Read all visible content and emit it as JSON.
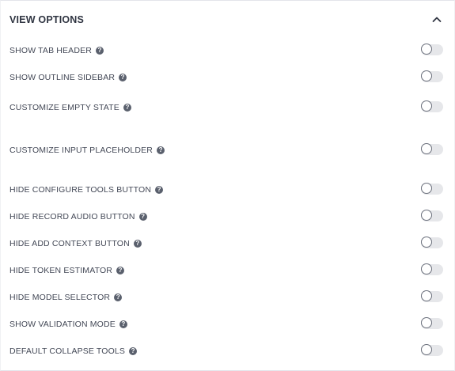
{
  "panel": {
    "title": "VIEW OPTIONS",
    "collapse_icon": "chevron-up-icon",
    "expanded": true
  },
  "options": [
    {
      "id": "show-tab-header",
      "label": "SHOW TAB HEADER",
      "enabled": false
    },
    {
      "id": "show-outline-sidebar",
      "label": "SHOW OUTLINE SIDEBAR",
      "enabled": false
    },
    {
      "id": "customize-empty-state",
      "label": "CUSTOMIZE EMPTY STATE",
      "enabled": false
    },
    {
      "id": "customize-input-placeholder",
      "label": "CUSTOMIZE INPUT PLACEHOLDER",
      "enabled": false
    },
    {
      "id": "hide-configure-tools-button",
      "label": "HIDE CONFIGURE TOOLS BUTTON",
      "enabled": false
    },
    {
      "id": "hide-record-audio-button",
      "label": "HIDE RECORD AUDIO BUTTON",
      "enabled": false
    },
    {
      "id": "hide-add-context-button",
      "label": "HIDE ADD CONTEXT BUTTON",
      "enabled": false
    },
    {
      "id": "hide-token-estimator",
      "label": "HIDE TOKEN ESTIMATOR",
      "enabled": false
    },
    {
      "id": "hide-model-selector",
      "label": "HIDE MODEL SELECTOR",
      "enabled": false
    },
    {
      "id": "show-validation-mode",
      "label": "SHOW VALIDATION MODE",
      "enabled": false
    },
    {
      "id": "default-collapse-tools",
      "label": "DEFAULT COLLAPSE TOOLS",
      "enabled": false
    }
  ],
  "help_icon": "help-circle-icon",
  "colors": {
    "toggle_track_off": "#e6e7ea",
    "toggle_knob_border": "#6b707c",
    "help_icon": "#5a606d",
    "text": "#434856"
  }
}
